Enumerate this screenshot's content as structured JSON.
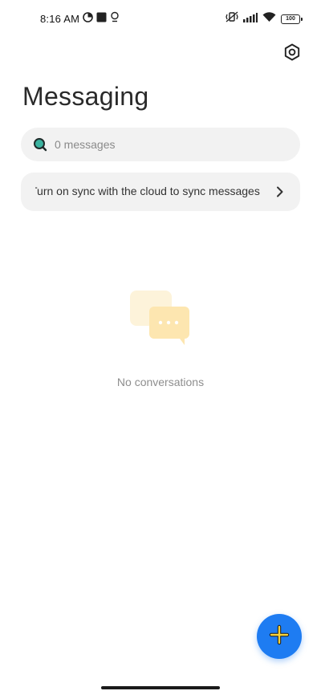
{
  "status_bar": {
    "time": "8:16 AM",
    "battery": "100",
    "icons": [
      "data-saver-icon",
      "stop-square-icon",
      "location-pin-icon",
      "vibrate-icon",
      "signal-icon",
      "wifi-icon",
      "battery-icon"
    ]
  },
  "header": {
    "title": "Messaging",
    "settings_icon": "settings-icon"
  },
  "search": {
    "placeholder": "0 messages"
  },
  "sync_banner": {
    "text": "Turn on sync with the cloud to sync messages"
  },
  "empty_state": {
    "icon": "chat-bubbles-icon",
    "text": "No conversations"
  },
  "fab": {
    "icon": "plus-icon"
  },
  "colors": {
    "accent": "#1e7cf2",
    "fab_plus": "#f7d33c",
    "search_icon": "#3bb3a0",
    "empty_illus": "#fde6b0"
  }
}
